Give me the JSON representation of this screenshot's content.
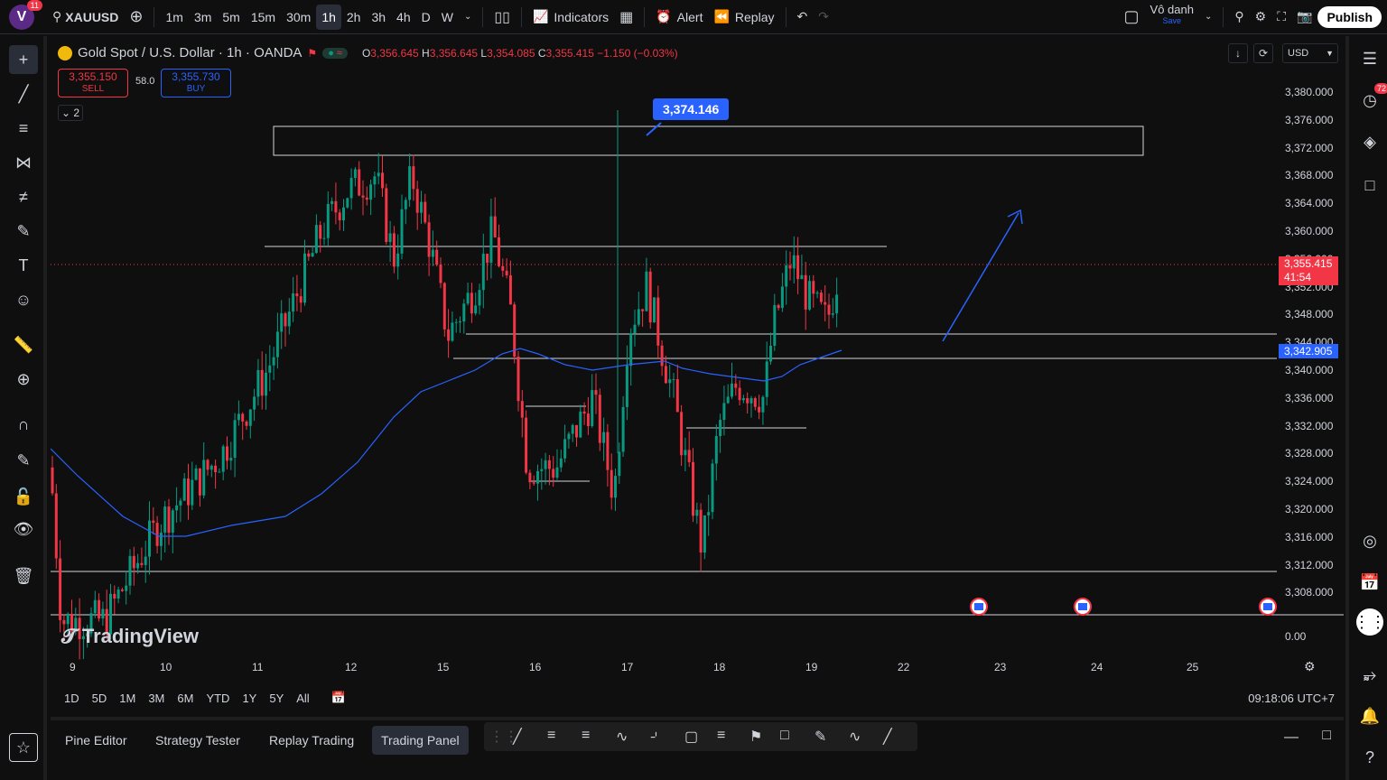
{
  "topbar": {
    "avatar_letter": "V",
    "avatar_badge": "11",
    "symbol": "XAUUSD",
    "timeframes": [
      "1m",
      "3m",
      "5m",
      "15m",
      "30m",
      "1h",
      "2h",
      "3h",
      "4h",
      "D",
      "W"
    ],
    "active_timeframe": "1h",
    "indicators_label": "Indicators",
    "alert_label": "Alert",
    "replay_label": "Replay",
    "user_name": "Vô danh",
    "save_label": "Save",
    "publish_label": "Publish"
  },
  "legend": {
    "title": "Gold Spot / U.S. Dollar · 1h · OANDA",
    "o_label": "O",
    "o": "3,356.645",
    "h_label": "H",
    "h": "3,356.645",
    "l_label": "L",
    "l": "3,354.085",
    "c_label": "C",
    "c": "3,355.415",
    "change": "−1.150 (−0.03%)"
  },
  "trade": {
    "sell_price": "3,355.150",
    "sell_label": "SELL",
    "spread": "58.0",
    "buy_price": "3,355.730",
    "buy_label": "BUY",
    "collapse_count": "2"
  },
  "currency": "USD",
  "price_axis": [
    "3,380.000",
    "3,376.000",
    "3,372.000",
    "3,368.000",
    "3,364.000",
    "3,360.000",
    "3,356.000",
    "3,352.000",
    "3,348.000",
    "3,344.000",
    "3,340.000",
    "3,336.000",
    "3,332.000",
    "3,328.000",
    "3,324.000",
    "3,320.000",
    "3,316.000",
    "3,312.000",
    "3,308.000",
    "0.00"
  ],
  "current_price": {
    "value": "3,355.415",
    "countdown": "41:54",
    "color": "#f23645"
  },
  "ma_price": {
    "value": "3,342.905",
    "color": "#2962ff"
  },
  "annotation": "3,374.146",
  "date_axis": [
    "9",
    "10",
    "11",
    "12",
    "15",
    "16",
    "17",
    "18",
    "19",
    "22",
    "23",
    "24",
    "25"
  ],
  "logo_text": "TradingView",
  "ranges": [
    "1D",
    "5D",
    "1M",
    "3M",
    "6M",
    "YTD",
    "1Y",
    "5Y",
    "All"
  ],
  "clock": "09:18:06 UTC+7",
  "bottom_tabs": [
    "Pine Editor",
    "Strategy Tester",
    "Replay Trading",
    "Trading Panel"
  ],
  "active_bottom_tab": "Trading Panel",
  "notifications_badge": "72",
  "colors": {
    "up": "#089981",
    "down": "#f23645",
    "ma": "#2962ff",
    "background": "#0f0f0f"
  }
}
